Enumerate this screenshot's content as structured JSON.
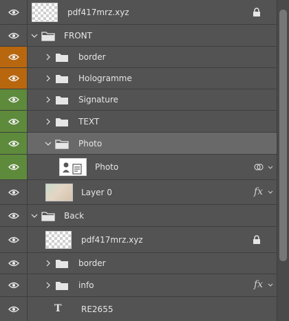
{
  "layers": [
    {
      "name": "pdf417mrz.xyz",
      "kind": "pixel",
      "visible": true,
      "locked": true
    },
    {
      "name": "FRONT",
      "kind": "group",
      "expanded": true,
      "visible": true
    },
    {
      "name": "border",
      "kind": "group",
      "expanded": false,
      "visible": true,
      "eye_color": "#b8670f"
    },
    {
      "name": "Hologramme",
      "kind": "group",
      "expanded": false,
      "visible": true,
      "eye_color": "#b8670f"
    },
    {
      "name": "Signature",
      "kind": "group",
      "expanded": false,
      "visible": true,
      "eye_color": "#5e8a3c"
    },
    {
      "name": "TEXT",
      "kind": "group",
      "expanded": false,
      "visible": true,
      "eye_color": "#5e8a3c"
    },
    {
      "name": "Photo",
      "kind": "group",
      "expanded": true,
      "visible": true,
      "eye_color": "#5e8a3c",
      "selected": true
    },
    {
      "name": "Photo",
      "kind": "smart-object",
      "visible": true,
      "eye_color": "#5e8a3c",
      "linked": true
    },
    {
      "name": "Layer 0",
      "kind": "pixel",
      "visible": true,
      "effects": "fx"
    },
    {
      "name": "Back",
      "kind": "group",
      "expanded": true,
      "visible": true
    },
    {
      "name": "pdf417mrz.xyz",
      "kind": "pixel",
      "visible": true,
      "locked": true
    },
    {
      "name": "border",
      "kind": "group",
      "expanded": false,
      "visible": true
    },
    {
      "name": "info",
      "kind": "group",
      "expanded": false,
      "visible": true,
      "effects": "fx"
    },
    {
      "name": "RE2655",
      "kind": "text",
      "visible": true
    }
  ],
  "colors": {
    "panel_bg": "#535353",
    "row_divider": "#3e3e3e",
    "selected_row": "#696969",
    "label_orange": "#b8670f",
    "label_green": "#5e8a3c"
  },
  "icons": {
    "visibility": "eye-icon",
    "expand": "chevron-right-icon",
    "collapse": "chevron-down-icon",
    "group": "folder-icon",
    "lock": "lock-icon",
    "effects": "fx-icon",
    "text_layer": "type-t-icon",
    "smart_object": "smart-object-icon"
  }
}
